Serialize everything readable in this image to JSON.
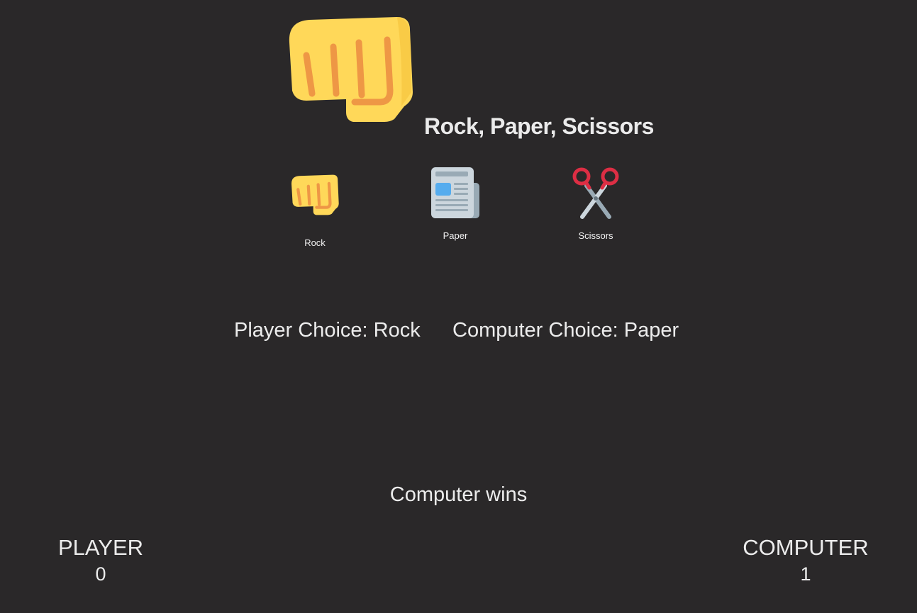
{
  "header": {
    "logo_icon": "fist-icon",
    "title": "Rock, Paper, Scissors"
  },
  "choices": [
    {
      "label": "Rock",
      "icon": "fist-icon"
    },
    {
      "label": "Paper",
      "icon": "newspaper-icon"
    },
    {
      "label": "Scissors",
      "icon": "scissors-icon"
    }
  ],
  "round": {
    "player_choice_text": "Player Choice: Rock",
    "computer_choice_text": "Computer Choice: Paper",
    "result_text": "Computer wins"
  },
  "scoreboard": {
    "player_label": "PLAYER",
    "player_score": "0",
    "computer_label": "COMPUTER",
    "computer_score": "1"
  },
  "colors": {
    "background": "#2a2829",
    "text": "#ececec",
    "fist_yellow": "#ffd859",
    "fist_stroke": "#ee9745",
    "scissors_red": "#dd2e44"
  }
}
